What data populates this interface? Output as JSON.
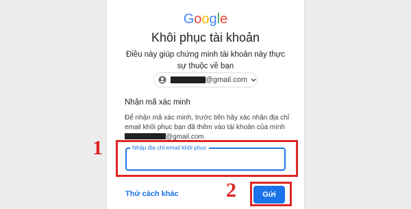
{
  "logo": {
    "letters": [
      "G",
      "o",
      "o",
      "g",
      "l",
      "e"
    ],
    "colors": [
      "#4285F4",
      "#EA4335",
      "#FBBC05",
      "#4285F4",
      "#34A853",
      "#EA4335"
    ]
  },
  "page": {
    "title": "Khôi phục tài khoản",
    "subtitle": "Điều này giúp chứng minh tài khoản này thực sự thuộc về bạn"
  },
  "account": {
    "icon": "account-circle-icon",
    "email_suffix": "@gmail.com",
    "dropdown_icon": "chevron-down-icon"
  },
  "verify": {
    "heading": "Nhận mã xác minh",
    "text": "Để nhận mã xác minh, trước tiên hãy xác nhận địa chỉ email khôi phục bạn đã thêm vào tài khoản của mình",
    "email_suffix": "@gmail.com"
  },
  "recovery_field": {
    "label": "Nhập địa chỉ email khôi phục",
    "value": ""
  },
  "actions": {
    "try_another": "Thử cách khác",
    "send": "Gửi"
  },
  "annotations": {
    "step1": "1",
    "step2": "2",
    "highlight_color": "#e02424"
  }
}
